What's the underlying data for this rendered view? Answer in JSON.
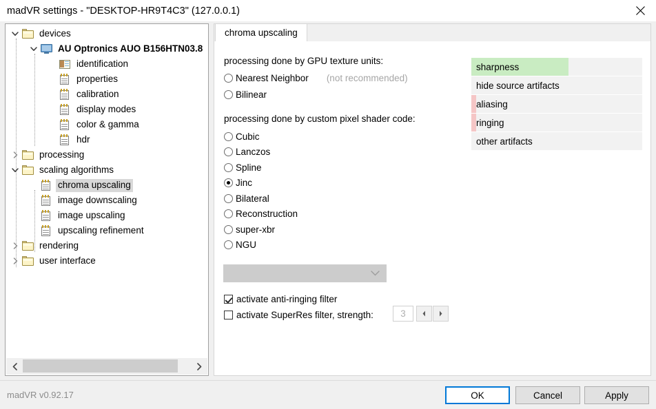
{
  "window": {
    "title": "madVR settings - \"DESKTOP-HR9T4C3\" (127.0.0.1)",
    "close_icon": "close-icon"
  },
  "tree": {
    "nodes": [
      {
        "label": "devices",
        "icon": "folder-icon",
        "twist": "expanded",
        "depth": 0,
        "bold": false,
        "selected": false
      },
      {
        "label": "AU Optronics AUO B156HTN03.8",
        "icon": "monitor-icon",
        "twist": "expanded",
        "depth": 1,
        "bold": true,
        "selected": false
      },
      {
        "label": "identification",
        "icon": "id-card-icon",
        "twist": "none",
        "depth": 2,
        "bold": false,
        "selected": false
      },
      {
        "label": "properties",
        "icon": "document-icon",
        "twist": "none",
        "depth": 2,
        "bold": false,
        "selected": false
      },
      {
        "label": "calibration",
        "icon": "document-icon",
        "twist": "none",
        "depth": 2,
        "bold": false,
        "selected": false
      },
      {
        "label": "display modes",
        "icon": "document-icon",
        "twist": "none",
        "depth": 2,
        "bold": false,
        "selected": false
      },
      {
        "label": "color & gamma",
        "icon": "document-icon",
        "twist": "none",
        "depth": 2,
        "bold": false,
        "selected": false
      },
      {
        "label": "hdr",
        "icon": "document-icon",
        "twist": "none",
        "depth": 2,
        "bold": false,
        "selected": false
      },
      {
        "label": "processing",
        "icon": "folder-icon",
        "twist": "collapsed",
        "depth": 0,
        "bold": false,
        "selected": false
      },
      {
        "label": "scaling algorithms",
        "icon": "folder-icon",
        "twist": "expanded",
        "depth": 0,
        "bold": false,
        "selected": false
      },
      {
        "label": "chroma upscaling",
        "icon": "document-icon",
        "twist": "none",
        "depth": 1,
        "bold": false,
        "selected": true
      },
      {
        "label": "image downscaling",
        "icon": "document-icon",
        "twist": "none",
        "depth": 1,
        "bold": false,
        "selected": false
      },
      {
        "label": "image upscaling",
        "icon": "document-icon",
        "twist": "none",
        "depth": 1,
        "bold": false,
        "selected": false
      },
      {
        "label": "upscaling refinement",
        "icon": "document-icon",
        "twist": "none",
        "depth": 1,
        "bold": false,
        "selected": false
      },
      {
        "label": "rendering",
        "icon": "folder-icon",
        "twist": "collapsed",
        "depth": 0,
        "bold": false,
        "selected": false
      },
      {
        "label": "user interface",
        "icon": "folder-icon",
        "twist": "collapsed",
        "depth": 0,
        "bold": false,
        "selected": false
      }
    ],
    "scrollbar": {
      "left_arrow_icon": "chevron-left-icon",
      "right_arrow_icon": "chevron-right-icon"
    }
  },
  "tabs": {
    "active": "chroma upscaling",
    "items": [
      "chroma upscaling"
    ]
  },
  "content": {
    "gpu_section_label": "processing done by GPU texture units:",
    "gpu_options": [
      {
        "label": "Nearest Neighbor",
        "selected": false,
        "note": "(not recommended)"
      },
      {
        "label": "Bilinear",
        "selected": false,
        "note": ""
      }
    ],
    "shader_section_label": "processing done by custom pixel shader code:",
    "shader_options": [
      {
        "label": "Cubic",
        "selected": false
      },
      {
        "label": "Lanczos",
        "selected": false
      },
      {
        "label": "Spline",
        "selected": false
      },
      {
        "label": "Jinc",
        "selected": true
      },
      {
        "label": "Bilateral",
        "selected": false
      },
      {
        "label": "Reconstruction",
        "selected": false
      },
      {
        "label": "super-xbr",
        "selected": false
      },
      {
        "label": "NGU",
        "selected": false
      }
    ],
    "variant_combo": {
      "value": "",
      "enabled": false,
      "chevron_icon": "chevron-down-icon"
    },
    "checkboxes": [
      {
        "label": "activate anti-ringing filter",
        "checked": true
      },
      {
        "label": "activate SuperRes filter, strength:",
        "checked": false
      }
    ],
    "superres_strength": {
      "value": "3",
      "enabled": false,
      "decrement_icon": "triangle-left-icon",
      "increment_icon": "triangle-right-icon"
    }
  },
  "quality_meters": {
    "colors": {
      "good": "#c9ecc2",
      "bad": "#f5c6c6",
      "track": "#f2f2f2"
    },
    "rows": [
      {
        "label": "sharpness",
        "fill_percent": 57,
        "fill_kind": "good"
      },
      {
        "label": "hide source artifacts",
        "fill_percent": 0,
        "fill_kind": "none"
      },
      {
        "label": "aliasing",
        "fill_percent": 3,
        "fill_kind": "bad"
      },
      {
        "label": "ringing",
        "fill_percent": 3,
        "fill_kind": "bad"
      },
      {
        "label": "other artifacts",
        "fill_percent": 0,
        "fill_kind": "none"
      }
    ]
  },
  "footer": {
    "version": "madVR v0.92.17",
    "buttons": [
      {
        "label": "OK",
        "default": true
      },
      {
        "label": "Cancel",
        "default": false
      },
      {
        "label": "Apply",
        "default": false
      }
    ]
  }
}
